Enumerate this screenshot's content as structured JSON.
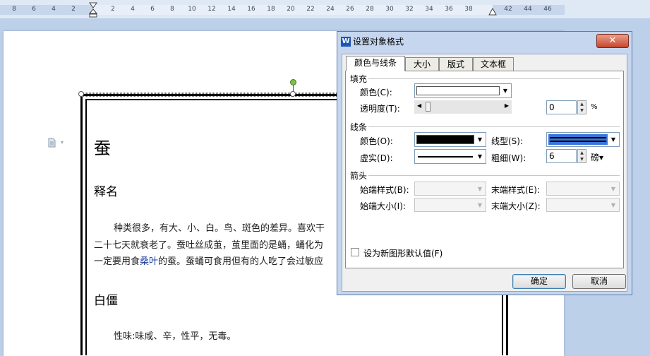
{
  "ruler": {
    "ticks": [
      "8",
      "6",
      "4",
      "2",
      "2",
      "4",
      "6",
      "8",
      "10",
      "12",
      "14",
      "16",
      "18",
      "20",
      "22",
      "24",
      "26",
      "28",
      "30",
      "32",
      "34",
      "36",
      "38",
      "42",
      "44",
      "46"
    ]
  },
  "document": {
    "title": "蚕",
    "heading1": "释名",
    "para_line1": "种类很多，有大、小、白。鸟、斑色的差异。喜欢干",
    "para_line2": "二十七天就衰老了。蚕吐丝成茧，茧里面的是蛹，蛹化为",
    "para_line3_pre": "一定要用食",
    "para_line3_link": "桑叶",
    "para_line3_post": "的蚕。蚕蛹可食用但有的人吃了会过敏应",
    "heading2": "白僵",
    "para_line4": "性味:味咸、辛，性平，无毒。"
  },
  "dialog": {
    "icon_letter": "W",
    "title": "设置对象格式",
    "close_symbol": "✕",
    "tabs": [
      "颜色与线条",
      "大小",
      "版式",
      "文本框"
    ],
    "active_tab": "颜色与线条",
    "fill": {
      "group_label": "填充",
      "color_label": "颜色(C):",
      "color_value": "#ffffff",
      "transparency_label": "透明度(T):",
      "transparency_value": "0",
      "transparency_unit": "%"
    },
    "line": {
      "group_label": "线条",
      "color_label": "颜色(O):",
      "color_value": "#000000",
      "style_label": "线型(S):",
      "dash_label": "虚实(D):",
      "weight_label": "粗细(W):",
      "weight_value": "6",
      "weight_unit": "磅▾"
    },
    "arrows": {
      "group_label": "箭头",
      "begin_style_label": "始端样式(B):",
      "end_style_label": "末端样式(E):",
      "begin_size_label": "始端大小(I):",
      "end_size_label": "末端大小(Z):"
    },
    "default_checkbox_label": "设为新图形默认值(F)",
    "default_checked": false,
    "ok_label": "确定",
    "cancel_label": "取消"
  }
}
